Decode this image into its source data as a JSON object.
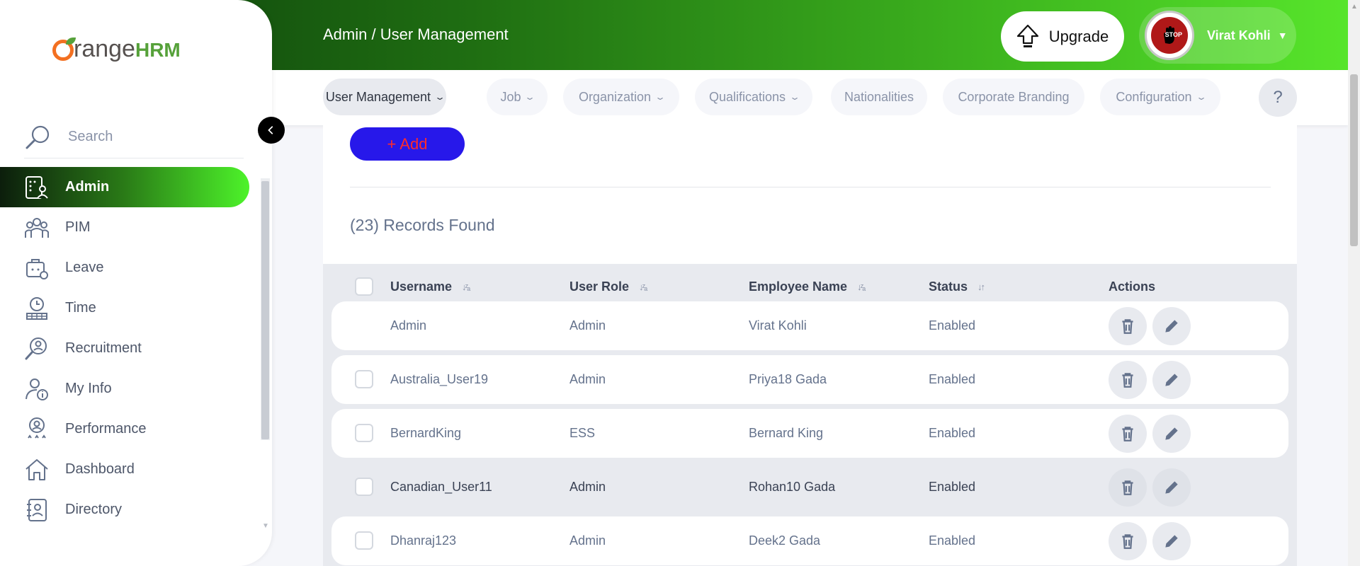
{
  "header": {
    "breadcrumb": "Admin / User Management",
    "upgrade_label": "Upgrade",
    "user_name": "Virat Kohli",
    "avatar_text": "STOP"
  },
  "subnav": {
    "tabs": [
      {
        "label": "User Management",
        "dropdown": true,
        "active": true
      },
      {
        "label": "Job",
        "dropdown": true
      },
      {
        "label": "Organization",
        "dropdown": true
      },
      {
        "label": "Qualifications",
        "dropdown": true
      },
      {
        "label": "Nationalities",
        "dropdown": false
      },
      {
        "label": "Corporate Branding",
        "dropdown": false
      },
      {
        "label": "Configuration",
        "dropdown": true
      }
    ],
    "help_label": "?"
  },
  "main": {
    "add_label": "+ Add",
    "records_label": "(23) Records Found",
    "columns": [
      "Username",
      "User Role",
      "Employee Name",
      "Status",
      "Actions"
    ],
    "rows": [
      {
        "username": "Admin",
        "role": "Admin",
        "employee": "Virat Kohli",
        "status": "Enabled",
        "checkbox": false
      },
      {
        "username": "Australia_User19",
        "role": "Admin",
        "employee": "Priya18 Gada",
        "status": "Enabled",
        "checkbox": true
      },
      {
        "username": "BernardKing",
        "role": "ESS",
        "employee": "Bernard King",
        "status": "Enabled",
        "checkbox": true
      },
      {
        "username": "Canadian_User11",
        "role": "Admin",
        "employee": "Rohan10 Gada",
        "status": "Enabled",
        "checkbox": true
      },
      {
        "username": "Dhanraj123",
        "role": "Admin",
        "employee": "Deek2 Gada",
        "status": "Enabled",
        "checkbox": true
      }
    ]
  },
  "sidebar": {
    "logo_text": "range",
    "logo_hrm": "HRM",
    "search_placeholder": "Search",
    "items": [
      {
        "label": "Admin",
        "icon": "admin-icon",
        "active": true
      },
      {
        "label": "PIM",
        "icon": "pim-icon"
      },
      {
        "label": "Leave",
        "icon": "leave-icon"
      },
      {
        "label": "Time",
        "icon": "time-icon"
      },
      {
        "label": "Recruitment",
        "icon": "recruitment-icon"
      },
      {
        "label": "My Info",
        "icon": "my-info-icon"
      },
      {
        "label": "Performance",
        "icon": "performance-icon"
      },
      {
        "label": "Dashboard",
        "icon": "dashboard-icon"
      },
      {
        "label": "Directory",
        "icon": "directory-icon"
      }
    ]
  },
  "colors": {
    "accent_green": "#3fb81f",
    "add_button_bg": "#2718ea",
    "add_button_text": "#ff2b2b"
  }
}
